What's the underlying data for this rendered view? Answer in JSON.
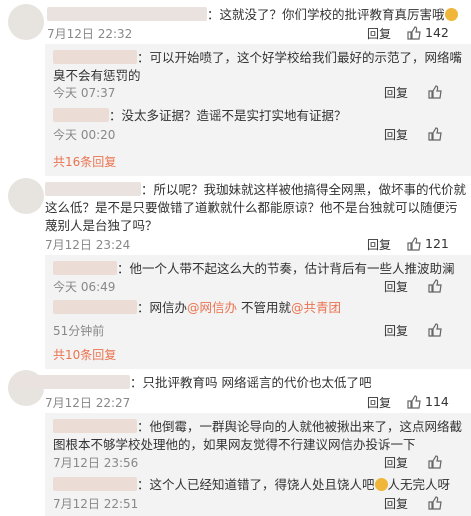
{
  "comments": [
    {
      "text": "：这就没了？你们学校的批评教育真厉害哦",
      "time": "7月12日 22:32",
      "reply_label": "回复",
      "likes": "142",
      "replies": [
        {
          "text": "：可以开始喷了，这个好学校给我们最好的示范了，网络嘴臭不会有惩罚的",
          "time": "今天 07:37",
          "reply_label": "回复"
        },
        {
          "text": "：没太多证据？造谣不是实打实地有证据？",
          "time": "今天 00:20",
          "reply_label": "回复"
        }
      ],
      "more": "共16条回复"
    },
    {
      "text": "：所以呢？我珈妹就这样被他搞得全网黑，做坏事的代价就这么低？是不是只要做错了道歉就什么都能原谅？他不是台独就可以随便污蔑别人是台独了吗？",
      "time": "7月12日 23:24",
      "reply_label": "回复",
      "likes": "121",
      "replies": [
        {
          "text": "：他一个人带不起这么大的节奏，估计背后有一些人推波助澜",
          "time": "今天 06:49",
          "reply_label": "回复"
        },
        {
          "text_prefix": "：网信办",
          "mention1": "@网信办",
          "text_mid": " 不管用就",
          "mention2": "@共青团",
          "time": "51分钟前",
          "reply_label": "回复"
        }
      ],
      "more": "共10条回复"
    },
    {
      "text": "：只批评教育吗 网络谣言的代价也太低了吧",
      "time": "7月12日 22:27",
      "reply_label": "回复",
      "likes": "114",
      "replies": [
        {
          "text": "：他倒霉，一群舆论导向的人就他被揪出来了，这点网络截图根本不够学校处理他的，如果网友觉得不行建议网信办投诉一下",
          "time": "7月12日 23:56",
          "reply_label": "回复"
        },
        {
          "text_prefix": "：这个人已经知道错了，得饶人处且饶人吧",
          "text_suffix": "人无完人呀",
          "time": "7月12日 22:51",
          "reply_label": "回复"
        }
      ]
    }
  ],
  "colors": {
    "link": "#eb7350",
    "reply_bg": "#f3f3f3",
    "time": "#888888"
  }
}
